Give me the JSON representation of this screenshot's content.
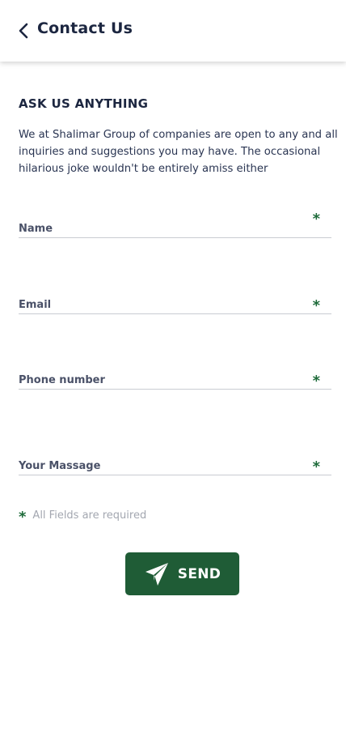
{
  "header": {
    "title": "Contact Us",
    "back_icon": "chevron-left-icon"
  },
  "section": {
    "title": "ASK US ANYTHING",
    "intro": "We at Shalimar Group of companies are open to any and all inquiries and suggestions you may have. The occasional hilarious joke wouldn't be entirely amiss either"
  },
  "form": {
    "name_placeholder": "Name",
    "email_placeholder": "Email",
    "phone_placeholder": "Phone number",
    "message_placeholder": "Your Massage",
    "required_marker": "*",
    "note": "All Fields are required",
    "send_label": "SEND",
    "send_icon": "send-icon"
  },
  "colors": {
    "accent": "#1f5c36",
    "required": "#1e6b3a",
    "title": "#1c2640"
  }
}
